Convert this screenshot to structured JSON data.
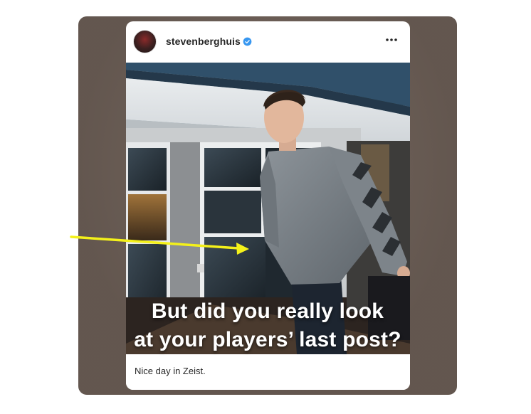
{
  "post": {
    "username": "stevenberghuis",
    "verified": true,
    "caption": "Nice day in Zeist."
  },
  "overlay": {
    "line1": "But did you really look",
    "line2": "at your players’ last post?"
  },
  "icons": {
    "verified": "verified-badge-icon",
    "more": "more-options-icon",
    "arrow": "annotation-arrow"
  },
  "colors": {
    "frame": "#6a5d55",
    "verified": "#3897f0",
    "arrow": "#f4f11a"
  }
}
